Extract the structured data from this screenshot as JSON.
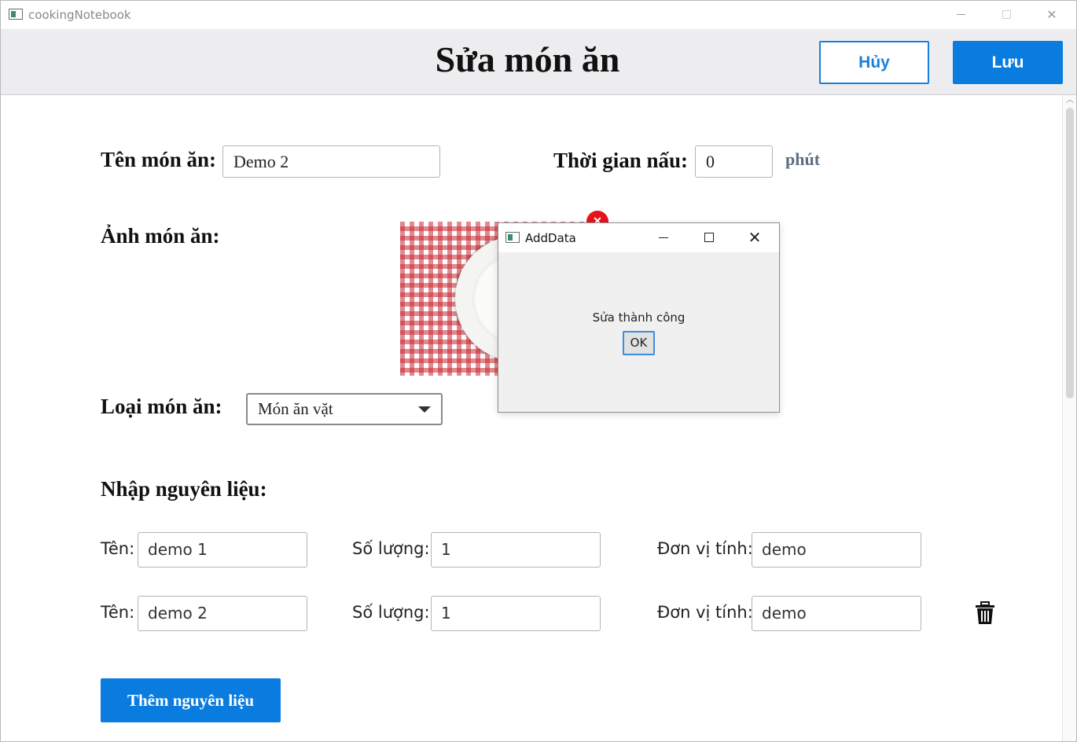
{
  "window": {
    "title": "cookingNotebook",
    "minimize_icon": "minimize-icon",
    "maximize_icon": "maximize-icon",
    "close_icon": "close-icon"
  },
  "header": {
    "title": "Sửa món ăn",
    "cancel_label": "Hủy",
    "save_label": "Lưu",
    "accent_color": "#0a7ce0"
  },
  "form": {
    "dish_name_label": "Tên món ăn:",
    "dish_name_value": "Demo 2",
    "cook_time_label": "Thời gian nấu:",
    "cook_time_value": "0",
    "cook_time_unit": "phút",
    "image_label": "Ảnh món ăn:",
    "image_remove_icon": "remove-icon",
    "category_label": "Loại món ăn:",
    "category_value": "Món ăn vặt",
    "ingredients_label": "Nhập nguyên liệu:"
  },
  "ingredients": [
    {
      "name_label": "Tên:",
      "name_value": "demo 1",
      "qty_label": "Số lượng:",
      "qty_value": "1",
      "unit_label": "Đơn vị tính:",
      "unit_value": "demo"
    },
    {
      "name_label": "Tên:",
      "name_value": "demo 2",
      "qty_label": "Số lượng:",
      "qty_value": "1",
      "unit_label": "Đơn vị tính:",
      "unit_value": "demo"
    }
  ],
  "add_ingredient_label": "Thêm nguyên liệu",
  "dialog": {
    "title": "AddData",
    "message": "Sửa thành công",
    "ok_label": "OK"
  }
}
